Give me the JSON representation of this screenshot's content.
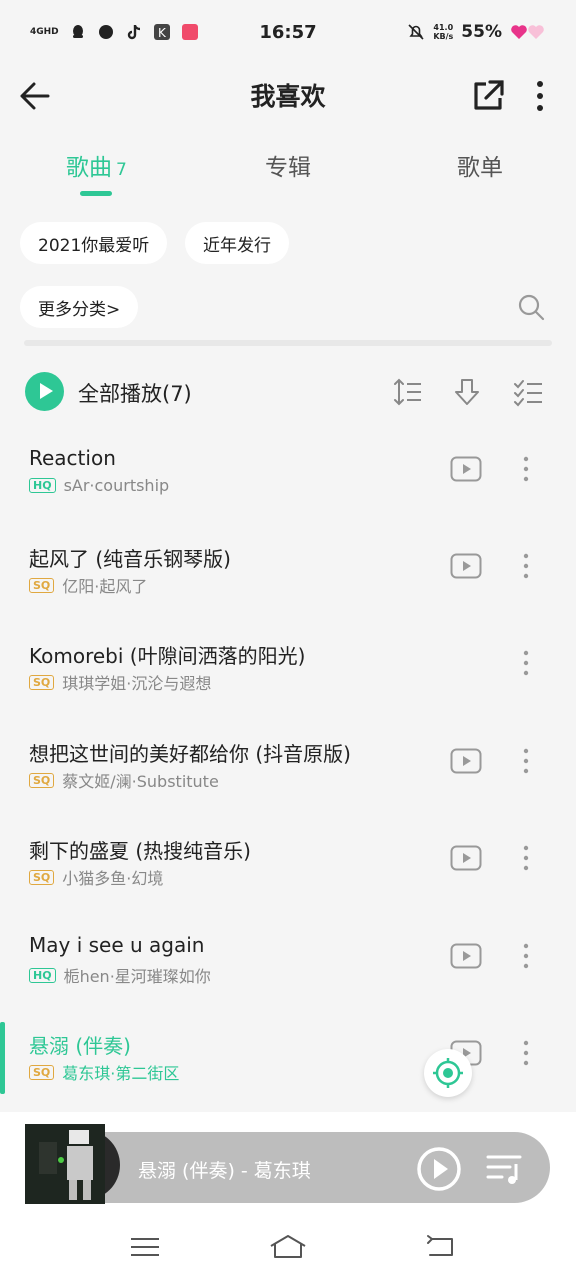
{
  "status_bar": {
    "network": "4GHD",
    "time": "16:57",
    "speed_value": "41.0",
    "speed_unit": "KB/s",
    "battery": "55%"
  },
  "header": {
    "title": "我喜欢"
  },
  "tabs": [
    {
      "label": "歌曲",
      "count": "7"
    },
    {
      "label": "专辑"
    },
    {
      "label": "歌单"
    }
  ],
  "chips": [
    "2021你最爱听",
    "近年发行",
    "更多分类>"
  ],
  "play_all": {
    "label": "全部播放(7)"
  },
  "songs": [
    {
      "title": "Reaction",
      "quality": "HQ",
      "artist": "sAr·courtship",
      "has_mv": true
    },
    {
      "title": "起风了 (纯音乐钢琴版)",
      "quality": "SQ",
      "artist": "亿阳·起风了",
      "has_mv": true
    },
    {
      "title": "Komorebi (叶隙间洒落的阳光)",
      "quality": "SQ",
      "artist": "琪琪学姐·沉沦与遐想",
      "has_mv": false
    },
    {
      "title": "想把这世间的美好都给你 (抖音原版)",
      "quality": "SQ",
      "artist": "蔡文姬/澜·Substitute",
      "has_mv": true
    },
    {
      "title": "剩下的盛夏 (热搜纯音乐)",
      "quality": "SQ",
      "artist": "小猫多鱼·幻境",
      "has_mv": true
    },
    {
      "title": "May i see u again",
      "quality": "HQ",
      "artist": "栀hen·星河璀璨如你",
      "has_mv": true
    },
    {
      "title": "悬溺 (伴奏)",
      "quality": "SQ",
      "artist": "葛东琪·第二街区",
      "has_mv": true,
      "playing": true
    }
  ],
  "now_playing": {
    "text": "悬溺 (伴奏) - 葛东琪"
  },
  "colors": {
    "accent": "#2ec795",
    "sq": "#e0a840",
    "hq": "#2ec795"
  }
}
